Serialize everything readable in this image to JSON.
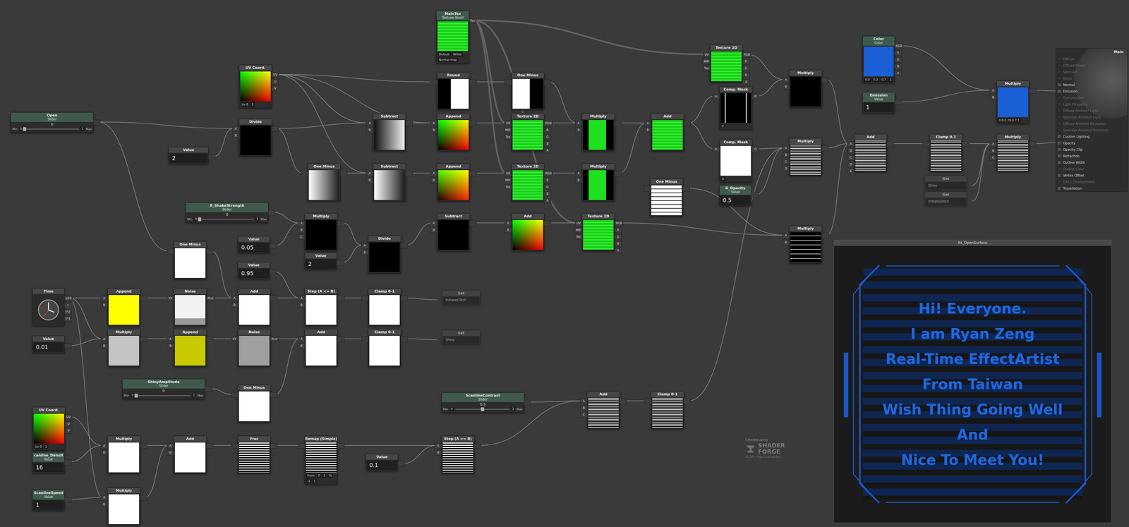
{
  "nodes": [
    {
      "kind": "asset",
      "title": "MainTex",
      "subtitle": "Texture Asset",
      "preview": "green",
      "inputs": [],
      "outputs": [
        "Tex"
      ],
      "footer": [
        "Default",
        "White",
        "Normal map"
      ]
    },
    {
      "kind": "op",
      "title": "UV Coord.",
      "preview": "uv",
      "inputs": [],
      "outputs": [
        "UV",
        "U",
        "V"
      ],
      "footer": [
        "Uv 0",
        "1"
      ]
    },
    {
      "kind": "slider",
      "title": "Open",
      "subtitle": "Slider",
      "value": "0",
      "min_label": "Min",
      "min": "0",
      "max": "1",
      "max_label": "Max",
      "level": 0,
      "outputs": [
        ""
      ]
    },
    {
      "kind": "value",
      "title": "Value",
      "value": "2",
      "outputs": [
        ""
      ]
    },
    {
      "kind": "op",
      "title": "Divide",
      "preview": "black",
      "inputs": [
        "A",
        "B"
      ],
      "outputs": [
        ""
      ]
    },
    {
      "kind": "op",
      "title": "Round",
      "preview": "round",
      "inputs": [
        ""
      ],
      "outputs": [
        ""
      ]
    },
    {
      "kind": "op",
      "title": "One Minus",
      "preview": "oneminus",
      "inputs": [
        ""
      ],
      "outputs": [
        ""
      ]
    },
    {
      "kind": "op",
      "title": "Subtract",
      "preview": "grad-dark",
      "inputs": [
        "A",
        "B"
      ],
      "outputs": [
        ""
      ]
    },
    {
      "kind": "op",
      "title": "Append",
      "preview": "uv",
      "inputs": [
        "A",
        "B"
      ],
      "outputs": [
        ""
      ]
    },
    {
      "kind": "op",
      "title": "Texture 2D",
      "preview": "green",
      "inputs": [
        "UV",
        "MIP",
        "Tex"
      ],
      "outputs": [
        "RGB",
        "R",
        "G",
        "B",
        "A"
      ]
    },
    {
      "kind": "op",
      "title": "Multiply",
      "preview": "green-slice",
      "inputs": [
        "A",
        "B"
      ],
      "outputs": [
        ""
      ]
    },
    {
      "kind": "op",
      "title": "Add",
      "preview": "green",
      "inputs": [
        "A",
        "B"
      ],
      "outputs": [
        ""
      ]
    },
    {
      "kind": "op",
      "title": "Texture 2D",
      "preview": "green",
      "inputs": [
        "UV",
        "MIP",
        "Tex"
      ],
      "outputs": [
        "RGB",
        "R",
        "G",
        "B",
        "A"
      ]
    },
    {
      "kind": "op",
      "title": "Comp. Mask",
      "preview": "mask-r",
      "inputs": [
        "In"
      ],
      "outputs": [
        "R"
      ],
      "footer": [
        "R"
      ]
    },
    {
      "kind": "op",
      "title": "Comp. Mask",
      "preview": "white",
      "inputs": [
        "In"
      ],
      "outputs": [
        "G"
      ],
      "footer": [
        "G"
      ]
    },
    {
      "kind": "value",
      "title": "G_Opacity",
      "subtitle": "Value",
      "value": "0.5",
      "outputs": [
        ""
      ]
    },
    {
      "kind": "op",
      "title": "Multiply",
      "preview": "black",
      "inputs": [
        "A",
        "B"
      ],
      "outputs": [
        ""
      ]
    },
    {
      "kind": "op",
      "title": "Multiply",
      "preview": "text-stripes",
      "inputs": [
        "A",
        "B",
        "C",
        "D"
      ],
      "outputs": [
        ""
      ]
    },
    {
      "kind": "op",
      "title": "Multiply",
      "preview": "text-black",
      "inputs": [
        "A",
        "B"
      ],
      "outputs": [
        ""
      ]
    },
    {
      "kind": "op",
      "title": "One Minus",
      "preview": "grad-light",
      "inputs": [
        ""
      ],
      "outputs": [
        ""
      ]
    },
    {
      "kind": "op",
      "title": "Subtract",
      "preview": "grad-light",
      "inputs": [
        "A",
        "B"
      ],
      "outputs": [
        ""
      ]
    },
    {
      "kind": "op",
      "title": "Append",
      "preview": "append2",
      "inputs": [
        "A",
        "B"
      ],
      "outputs": [
        ""
      ]
    },
    {
      "kind": "op",
      "title": "Texture 2D",
      "preview": "green",
      "inputs": [
        "UV",
        "MIP",
        "Tex"
      ],
      "outputs": [
        "RGB",
        "R",
        "G",
        "B",
        "A"
      ]
    },
    {
      "kind": "op",
      "title": "Multiply",
      "preview": "green-slice",
      "inputs": [
        "A",
        "B"
      ],
      "outputs": [
        ""
      ]
    },
    {
      "kind": "op",
      "title": "One Minus",
      "preview": "text-white",
      "inputs": [
        ""
      ],
      "outputs": [
        ""
      ]
    },
    {
      "kind": "slider",
      "title": "R_ShakeStrength",
      "subtitle": "Slider",
      "value": "0",
      "min_label": "Min",
      "min": "0",
      "max": "1",
      "max_label": "Max",
      "level": 0,
      "outputs": [
        ""
      ]
    },
    {
      "kind": "value",
      "title": "Value",
      "value": "0.05",
      "outputs": [
        ""
      ]
    },
    {
      "kind": "value",
      "title": "Value",
      "value": "0.95",
      "outputs": [
        ""
      ]
    },
    {
      "kind": "op",
      "title": "Multiply",
      "preview": "black",
      "inputs": [
        "A",
        "B",
        "C"
      ],
      "outputs": [
        ""
      ]
    },
    {
      "kind": "value",
      "title": "Value",
      "value": "2",
      "outputs": [
        ""
      ]
    },
    {
      "kind": "op",
      "title": "Divide",
      "preview": "black",
      "inputs": [
        "A",
        "B"
      ],
      "outputs": [
        ""
      ]
    },
    {
      "kind": "op",
      "title": "Subtract",
      "preview": "black",
      "inputs": [
        "A",
        "B"
      ],
      "outputs": [
        ""
      ]
    },
    {
      "kind": "op",
      "title": "Add",
      "preview": "uv",
      "inputs": [
        "A",
        "B"
      ],
      "outputs": [
        ""
      ]
    },
    {
      "kind": "op",
      "title": "Texture 2D",
      "preview": "green",
      "inputs": [
        "UV",
        "MIP",
        "Tex"
      ],
      "outputs": [
        "RGB",
        "R",
        "G",
        "B",
        "A"
      ]
    },
    {
      "kind": "op",
      "title": "One Minus",
      "preview": "white",
      "inputs": [
        ""
      ],
      "outputs": [
        ""
      ]
    },
    {
      "kind": "op",
      "title": "Time",
      "preview": "clock",
      "inputs": [],
      "outputs": [
        "t/20",
        "t",
        "t*2",
        "t*3"
      ]
    },
    {
      "kind": "value",
      "title": "Value",
      "value": "0.01",
      "outputs": [
        ""
      ]
    },
    {
      "kind": "op",
      "title": "Append",
      "preview": "yellow",
      "inputs": [
        "A",
        "B"
      ],
      "outputs": [
        ""
      ]
    },
    {
      "kind": "op",
      "title": "Noise",
      "preview": "noise-light",
      "inputs": [
        "XY"
      ],
      "outputs": [
        "Rnd"
      ]
    },
    {
      "kind": "op",
      "title": "Add",
      "preview": "white",
      "inputs": [
        "A",
        "B"
      ],
      "outputs": [
        ""
      ]
    },
    {
      "kind": "op",
      "title": "Step (A <= B)",
      "preview": "white",
      "inputs": [
        "A",
        "B"
      ],
      "outputs": [
        ""
      ]
    },
    {
      "kind": "op",
      "title": "Clamp 0-1",
      "preview": "white",
      "inputs": [
        ""
      ],
      "outputs": [
        ""
      ]
    },
    {
      "kind": "var",
      "title": "Set",
      "value": "InitiateGlitch"
    },
    {
      "kind": "op",
      "title": "Multiply",
      "preview": "grey",
      "inputs": [
        "A",
        "B"
      ],
      "outputs": [
        ""
      ]
    },
    {
      "kind": "op",
      "title": "Append",
      "preview": "olive",
      "inputs": [
        "A",
        "B"
      ],
      "outputs": [
        ""
      ]
    },
    {
      "kind": "op",
      "title": "Noise",
      "preview": "noise-grey",
      "inputs": [
        "XY"
      ],
      "outputs": [
        "Rnd"
      ]
    },
    {
      "kind": "op",
      "title": "Add",
      "preview": "white",
      "inputs": [
        "A",
        "B"
      ],
      "outputs": [
        ""
      ]
    },
    {
      "kind": "op",
      "title": "Clamp 0-1",
      "preview": "white",
      "inputs": [
        ""
      ],
      "outputs": [
        ""
      ]
    },
    {
      "kind": "var",
      "title": "Set",
      "value": "Shiny"
    },
    {
      "kind": "slider",
      "title": "ShinyAmplitude",
      "subtitle": "Slider",
      "value": "0",
      "min_label": "Min",
      "min": "0",
      "max": "1",
      "max_label": "Max",
      "level": 0,
      "outputs": [
        ""
      ]
    },
    {
      "kind": "op",
      "title": "One Minus",
      "preview": "white",
      "inputs": [
        ""
      ],
      "outputs": [
        ""
      ]
    },
    {
      "kind": "op",
      "title": "UV Coord.",
      "preview": "uv",
      "inputs": [],
      "outputs": [
        "UV",
        "U",
        "V"
      ],
      "footer": [
        "Uv 0",
        "1"
      ]
    },
    {
      "kind": "value",
      "title": "canline_Densit",
      "subtitle": "Value",
      "value": "16",
      "outputs": [
        ""
      ]
    },
    {
      "kind": "value",
      "title": "ScanlineSpeed",
      "subtitle": "Value",
      "value": "1",
      "outputs": [
        ""
      ]
    },
    {
      "kind": "op",
      "title": "Multiply",
      "preview": "white",
      "inputs": [
        "A",
        "B"
      ],
      "outputs": [
        ""
      ]
    },
    {
      "kind": "op",
      "title": "Add",
      "preview": "white",
      "inputs": [
        "A",
        "B"
      ],
      "outputs": [
        ""
      ]
    },
    {
      "kind": "op",
      "title": "Frac",
      "preview": "stripes",
      "inputs": [
        ""
      ],
      "outputs": [
        ""
      ]
    },
    {
      "kind": "op",
      "title": "Remap (Simple)",
      "preview": "stripes",
      "inputs": [
        ""
      ],
      "outputs": [
        ""
      ],
      "footer": [
        "From",
        "0",
        "1",
        "To",
        "-1",
        "1"
      ]
    },
    {
      "kind": "value",
      "title": "Value",
      "value": "0.1",
      "outputs": [
        ""
      ]
    },
    {
      "kind": "slider",
      "title": "ScanlineContrast",
      "subtitle": "Slider",
      "value": "0.5",
      "min_label": "Min",
      "min": "0",
      "max": "1",
      "max_label": "Max",
      "level": 0.5,
      "outputs": [
        ""
      ]
    },
    {
      "kind": "op",
      "title": "Step (A <= B)",
      "preview": "stripes",
      "inputs": [
        "A",
        "B"
      ],
      "outputs": [
        ""
      ]
    },
    {
      "kind": "op",
      "title": "Multiply",
      "preview": "white",
      "inputs": [
        "A",
        "B"
      ],
      "outputs": [
        ""
      ]
    },
    {
      "kind": "op",
      "title": "Add",
      "preview": "text-stripes",
      "inputs": [
        "A",
        "B",
        "C"
      ],
      "outputs": [
        ""
      ]
    },
    {
      "kind": "op",
      "title": "Clamp 0-1",
      "preview": "text-stripes",
      "inputs": [
        ""
      ],
      "outputs": [
        ""
      ]
    },
    {
      "kind": "asset",
      "title": "Color",
      "subtitle": "Color",
      "preview": "blue",
      "inputs": [],
      "outputs": [
        "RGB",
        "R",
        "G",
        "B",
        "A"
      ],
      "footer": [
        "0.0",
        "0.3",
        "0.7",
        "1"
      ]
    },
    {
      "kind": "value",
      "title": "Emission",
      "subtitle": "Value",
      "value": "1",
      "outputs": [
        ""
      ]
    },
    {
      "kind": "op",
      "title": "Add",
      "preview": "text-stripes",
      "inputs": [
        "A",
        "B",
        "C",
        "D",
        "E"
      ],
      "outputs": [
        ""
      ]
    },
    {
      "kind": "op",
      "title": "Clamp 0-1",
      "preview": "text-stripes",
      "inputs": [
        ""
      ],
      "outputs": [
        ""
      ]
    },
    {
      "kind": "var",
      "title": "Get",
      "value": "Shiny"
    },
    {
      "kind": "var",
      "title": "Get",
      "value": "InitiateGlitch"
    },
    {
      "kind": "op",
      "title": "Multiply",
      "preview": "text-stripes",
      "inputs": [
        "A",
        "B",
        "C"
      ],
      "outputs": [
        ""
      ]
    },
    {
      "kind": "op",
      "title": "Multiply",
      "preview": "blue",
      "inputs": [
        "A",
        "B"
      ],
      "outputs": [
        ""
      ],
      "footer": [
        "0.0,0.29,0.7,1"
      ]
    }
  ],
  "main": {
    "title": "Main",
    "inputs": [
      {
        "label": "Diffuse",
        "enabled": false
      },
      {
        "label": "Diffuse Power",
        "enabled": false
      },
      {
        "label": "Specular",
        "enabled": false
      },
      {
        "label": "Gloss",
        "enabled": false
      },
      {
        "label": "Normal",
        "enabled": true
      },
      {
        "label": "Emission",
        "enabled": true
      },
      {
        "label": "Transmission",
        "enabled": false
      },
      {
        "label": "Light Wrapping",
        "enabled": false
      },
      {
        "label": "Diffuse Ambient Light",
        "enabled": false
      },
      {
        "label": "Specular Ambient Light",
        "enabled": false
      },
      {
        "label": "Diffuse Ambient Occlusion",
        "enabled": false
      },
      {
        "label": "Specular Ambient Occlusion",
        "enabled": false
      },
      {
        "label": "Custom Lighting",
        "enabled": true
      },
      {
        "label": "Opacity",
        "enabled": true
      },
      {
        "label": "Opacity Clip",
        "enabled": true
      },
      {
        "label": "Refraction",
        "enabled": true
      },
      {
        "label": "Outline Width",
        "enabled": true
      },
      {
        "label": "Outline Color",
        "enabled": false
      },
      {
        "label": "Vertex Offset",
        "enabled": true
      },
      {
        "label": "DX11 Displacement",
        "enabled": false
      },
      {
        "label": "Tessellation",
        "enabled": true
      }
    ]
  },
  "preview": {
    "title": "Rs_OpenSurface",
    "lines": [
      "Hi! Everyone.",
      "I am Ryan Zeng",
      "Real-Time EffectArtist",
      "From Taiwan",
      "Wish Thing Going Well",
      "And",
      "Nice To Meet You!"
    ]
  },
  "logo": {
    "caption": "Created using",
    "name": [
      "SHADER",
      "FORGE"
    ],
    "version": "v1.38 - http://u3d.as/6cc"
  }
}
